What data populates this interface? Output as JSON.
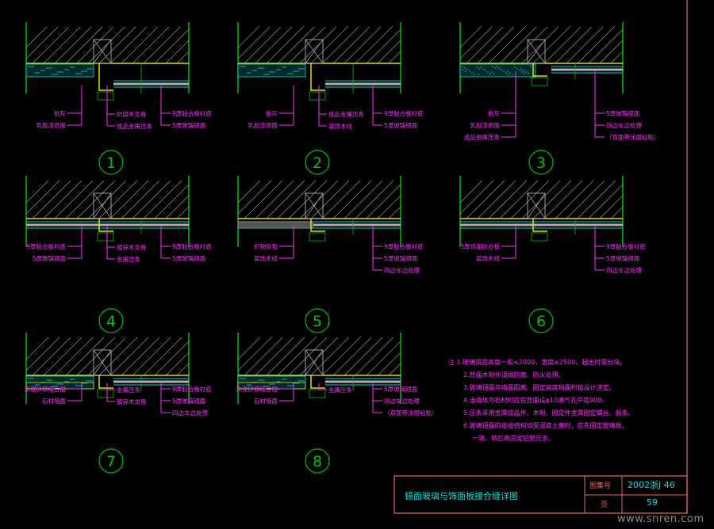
{
  "colors": {
    "background": "#000000",
    "wall": "#00c000",
    "hatch": "#8c8c8c",
    "ceiling": "#e0e000",
    "layer": "#00d8d8",
    "label": "#ff2cff",
    "frame": "#e06a6a",
    "title": "#00e0e0"
  },
  "details": [
    {
      "number": "1",
      "left": [
        "批灰",
        "乳胶漆饰面"
      ],
      "center": [
        "防腐木龙骨",
        "成品金属压条"
      ],
      "right": [
        "9厚胶合板衬底",
        "5厚玻璃镜面"
      ]
    },
    {
      "number": "2",
      "left": [
        "批灰",
        "乳胶漆饰面"
      ],
      "center": [
        "成品金属压条",
        "装饰木线"
      ],
      "right": [
        "9厚胶合板衬底",
        "5厚玻璃镜面"
      ]
    },
    {
      "number": "3",
      "left": [
        "批灰",
        "乳胶漆饰面",
        "成品金属压条"
      ],
      "center": [],
      "right": [
        "5厚玻璃镜面",
        "四边车边处理",
        "（双面带涂层粘贴）"
      ]
    },
    {
      "number": "4",
      "left": [
        "9厚胶合板衬底",
        "5厚玻璃镜面"
      ],
      "center": [
        "镀锌木龙骨",
        "金属压条"
      ],
      "right": [
        "9厚胶合板衬底",
        "5厚玻璃镜面"
      ]
    },
    {
      "number": "5",
      "left": [
        "织物软包",
        "装饰木线"
      ],
      "center": [],
      "right": [
        "9厚胶合板衬底",
        "5厚玻璃镜面",
        "四边车边处理"
      ]
    },
    {
      "number": "6",
      "left": [
        "3厚饰面胶合板",
        "装饰木线"
      ],
      "center": [],
      "right": [
        "9厚胶合板衬底",
        "5厚玻璃镜面",
        "四边车边处理"
      ]
    },
    {
      "number": "7",
      "left": [
        "水泥砂浆结合层",
        "石材墙面"
      ],
      "center": [
        "金属压条",
        "镀锌木龙骨"
      ],
      "right": [
        "9厚胶合板衬底",
        "5厚玻璃镜面",
        "四边车边处理"
      ]
    },
    {
      "number": "8",
      "left": [
        "水泥砂浆结合层",
        "石材墙面"
      ],
      "center": [
        "金属压条"
      ],
      "right": [
        "5厚玻璃镜面",
        "四边车边处理",
        "（双面带涂层粘贴）"
      ]
    }
  ],
  "notes": [
    "注 1.玻璃镜面高度一般≤2000，宽度≤2500，超出时需分块。",
    "2.背面木制作须做防腐、防火处理。",
    "3.玻璃镜面与墙面距离、固定高度和面积按设计决定。",
    "4.当墙体为石材时应在背面设φ10通气孔中距900。",
    "5.压条采用金属成品件、木制、固定件金属固定螺丝、胶条。",
    "6.玻璃镜面的连接结构如受湿度土磨时，应先固定玻璃板，",
    "一端、稍后再固定铝塑压条。"
  ],
  "title_block": {
    "title": "镜面玻璃与饰面板接合缝详图",
    "atlas_label": "图集号",
    "atlas_value": "2002浙J  46",
    "page_label": "页",
    "page_value": "59"
  },
  "watermark": "www.snren.com"
}
